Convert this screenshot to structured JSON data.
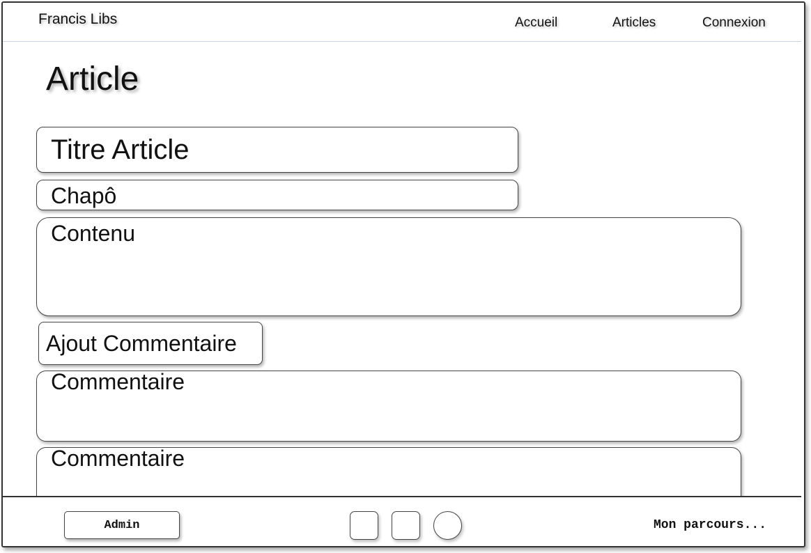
{
  "header": {
    "brand": "Francis Libs",
    "nav": [
      {
        "label": "Accueil"
      },
      {
        "label": "Articles"
      },
      {
        "label": "Connexion"
      }
    ]
  },
  "main": {
    "page_title": "Article",
    "title_field": "Titre Article",
    "chapo_field": "Chapô",
    "content_field": "Contenu",
    "add_comment_button": "Ajout Commentaire",
    "comments": [
      {
        "label": "Commentaire"
      },
      {
        "label": "Commentaire"
      }
    ]
  },
  "footer": {
    "admin_button": "Admin",
    "tagline": "Mon parcours..."
  }
}
